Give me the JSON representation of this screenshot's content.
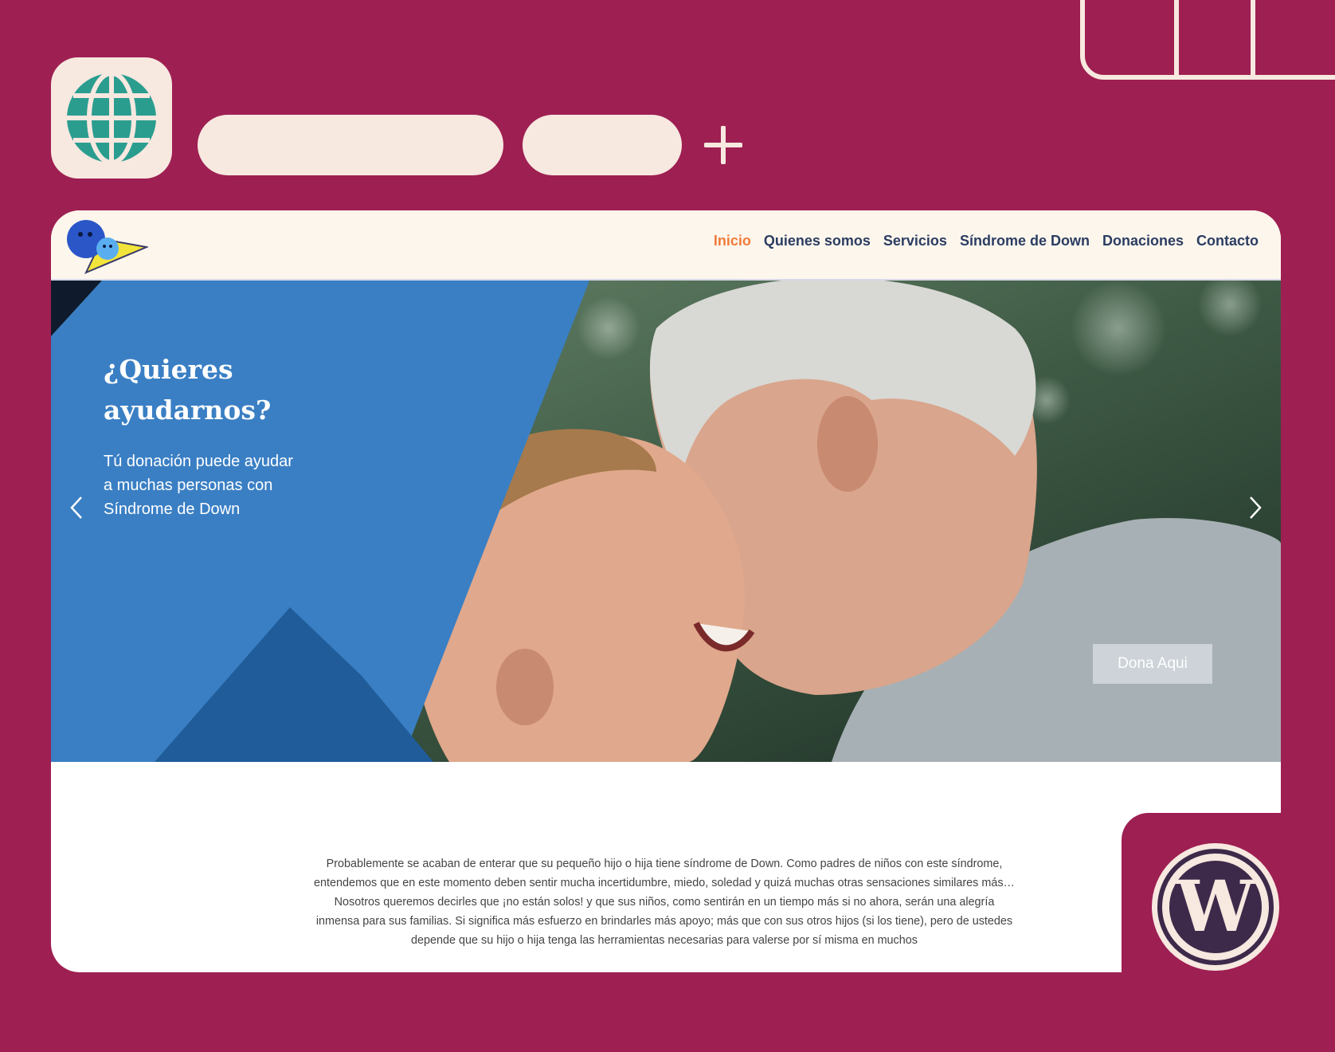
{
  "icons": {
    "globe": "globe-icon",
    "plus": "plus-icon",
    "wordpress": "wordpress-logo-icon",
    "prev": "chevron-left-icon",
    "next": "chevron-right-icon"
  },
  "colors": {
    "background": "#9e1f52",
    "cream": "#f7e8e0",
    "globe": "#2a9d8f",
    "nav_text": "#2b3d63",
    "nav_active": "#f07c3a",
    "hero_blue": "#3a7fc4",
    "hero_dark_blue": "#1f5c99",
    "wordpress": "#3d2a4a"
  },
  "site": {
    "nav": [
      {
        "label": "Inicio",
        "active": true
      },
      {
        "label": "Quienes somos",
        "active": false
      },
      {
        "label": "Servicios",
        "active": false
      },
      {
        "label": "Síndrome de Down",
        "active": false
      },
      {
        "label": "Donaciones",
        "active": false
      },
      {
        "label": "Contacto",
        "active": false
      }
    ]
  },
  "hero": {
    "title": "¿Quieres ayudarnos?",
    "subtitle": "Tú donación puede ayudar a muchas personas con Síndrome de Down",
    "button": "Dona Aqui"
  },
  "intro": {
    "p1": "Probablemente se acaban de enterar que su pequeño hijo o hija tiene síndrome de Down. Como padres de niños con este síndrome, entendemos que en este momento deben sentir mucha incertidumbre, miedo, soledad y quizá muchas otras sensaciones similares más…",
    "p2": "Nosotros queremos decirles que ¡no están solos! y que sus niños, como sentirán en un tiempo más si no ahora, serán una alegría inmensa para sus familias. Si significa más esfuerzo en brindarles más apoyo; más que con sus otros hijos (si los tiene), pero de ustedes depende que su hijo o hija tenga las herramientas necesarias para valerse por sí misma en muchos"
  }
}
